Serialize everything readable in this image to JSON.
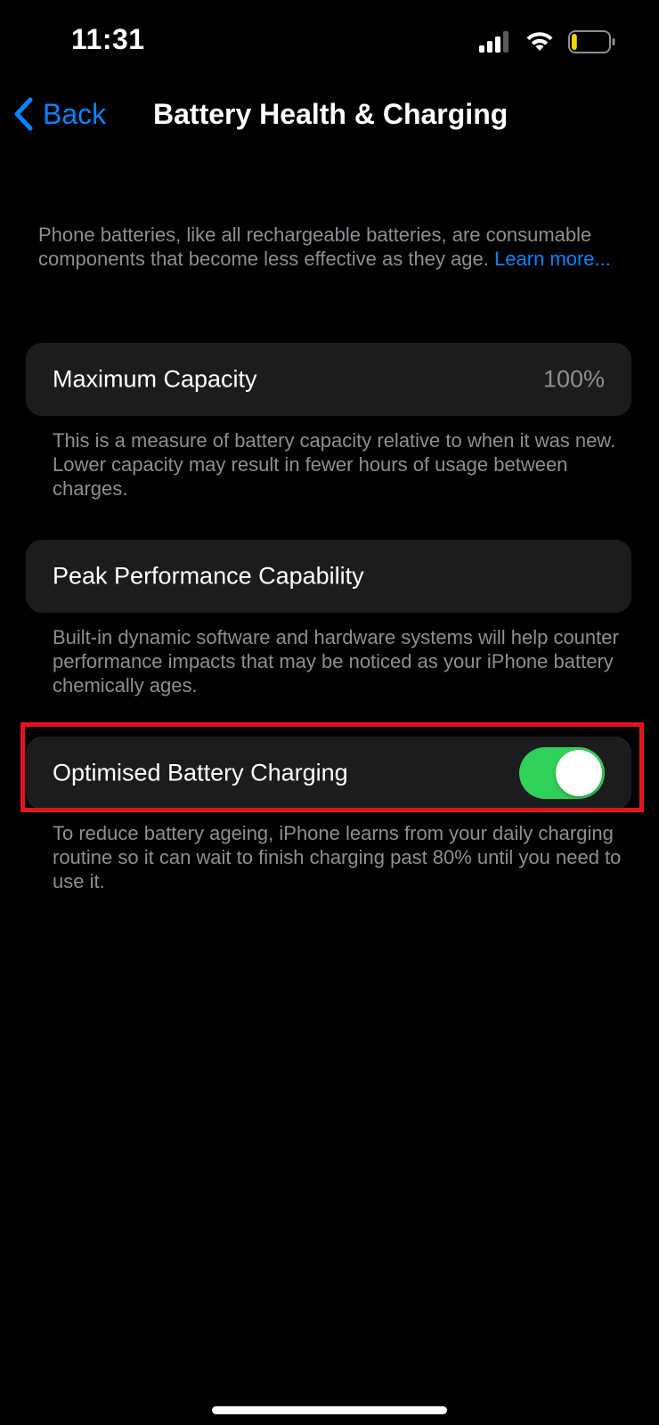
{
  "status_bar": {
    "time": "11:31",
    "icons": [
      "signal-icon",
      "wifi-icon",
      "battery-icon"
    ],
    "battery_level_fraction": 0.12,
    "battery_color": "#f5d10a"
  },
  "nav": {
    "back_label": "Back",
    "back_icon": "chevron-left-icon",
    "title": "Battery Health & Charging"
  },
  "intro": {
    "text": "Phone batteries, like all rechargeable batteries, are consumable components that become less effective as they age.",
    "link": "Learn more..."
  },
  "maximum_capacity": {
    "label": "Maximum Capacity",
    "value": "100%",
    "footer": "This is a measure of battery capacity relative to when it was new. Lower capacity may result in fewer hours of usage between charges."
  },
  "peak_performance": {
    "label": "Peak Performance Capability",
    "footer": "Built-in dynamic software and hardware systems will help counter performance impacts that may be noticed as your iPhone battery chemically ages."
  },
  "optimised_charging": {
    "label": "Optimised Battery Charging",
    "enabled": true,
    "footer": "To reduce battery ageing, iPhone learns from your daily charging routine so it can wait to finish charging past 80% until you need to use it."
  },
  "colors": {
    "accent": "#0a84ff",
    "toggle_on": "#30d158",
    "highlight": "#e3141b",
    "card_bg": "#1c1c1e",
    "secondary_text": "#8e8e93"
  }
}
